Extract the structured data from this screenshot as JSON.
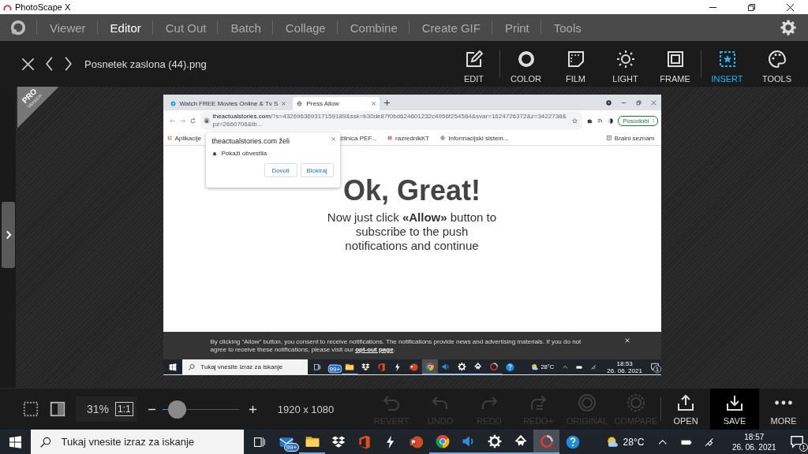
{
  "window": {
    "title": "PhotoScape X"
  },
  "menu": [
    {
      "label": "Viewer",
      "selected": false
    },
    {
      "label": "Editor",
      "selected": true
    },
    {
      "label": "Cut Out",
      "selected": false
    },
    {
      "label": "Batch",
      "selected": false
    },
    {
      "label": "Collage",
      "selected": false
    },
    {
      "label": "Combine",
      "selected": false
    },
    {
      "label": "Create GIF",
      "selected": false
    },
    {
      "label": "Print",
      "selected": false
    },
    {
      "label": "Tools",
      "selected": false
    }
  ],
  "file_name": "Posnetek zaslona (44).png",
  "tool_groups": [
    [
      {
        "kind": "edit",
        "label": "EDIT",
        "selected": false
      }
    ],
    [
      {
        "kind": "color",
        "label": "COLOR",
        "selected": false
      },
      {
        "kind": "film",
        "label": "FILM",
        "selected": false
      },
      {
        "kind": "light",
        "label": "LIGHT",
        "selected": false
      },
      {
        "kind": "frame",
        "label": "FRAME",
        "selected": false
      }
    ],
    [
      {
        "kind": "insert",
        "label": "INSERT",
        "selected": true
      },
      {
        "kind": "palette",
        "label": "TOOLS",
        "selected": false
      }
    ]
  ],
  "pro_ribbon": {
    "title": "PRO",
    "subtitle": "Version"
  },
  "screenshot": {
    "tabs": [
      {
        "kind": "video",
        "title": "Watch FREE Movies Online & Tv S",
        "selected": false
      },
      {
        "kind": "globe",
        "title": "Press Allow",
        "selected": true
      }
    ],
    "url_host": "theactualstories.com",
    "url_rest": "/?s=432696369317159189&ssk=b30de87f0bd624601232c4956f254584&svar=1624726372&z=3422738&pz=2660706&tb...",
    "update_button": "Posodobi",
    "bookmarks": [
      {
        "kind": "apps",
        "label": "Aplikacije"
      },
      {
        "kind": "none",
        "label": "čilnica PEF..."
      },
      {
        "kind": "flag",
        "label": "razrednikKT"
      },
      {
        "kind": "globe",
        "label": "Informacijski sistem..."
      }
    ],
    "reading_list": "Bralni seznam",
    "popup": {
      "title": "theactualstories.com želi",
      "permission": "Pokaži obvestila",
      "buttons": [
        "Dovoli",
        "Blokiraj"
      ]
    },
    "heading": "Ok, Great!",
    "message": "Now just click **«Allow»** button to subscribe to the push notifications and continue",
    "notice": {
      "text": "By clicking \"Allow\" button, you consent to receive notifications. The notifications provide news and advertising materials. If you do not agree to receive these notifications, please visit our",
      "link": "opt-out page",
      "end": "."
    },
    "taskbar": {
      "search_placeholder": "Tukaj vnesite izraz za iskanje",
      "apps": [
        {
          "kind": "mail",
          "badge": "99+",
          "running": false,
          "selected": false
        },
        {
          "kind": "folder",
          "running": true,
          "selected": false
        },
        {
          "kind": "dropbox",
          "running": false,
          "selected": false
        },
        {
          "kind": "office",
          "running": false,
          "selected": false
        },
        {
          "kind": "bolt",
          "running": false,
          "selected": false
        },
        {
          "kind": "powerpoint",
          "running": false,
          "selected": false
        },
        {
          "kind": "chrome",
          "running": true,
          "selected": true
        },
        {
          "kind": "speaker",
          "running": true,
          "selected": false
        },
        {
          "kind": "gear",
          "running": true,
          "selected": false
        },
        {
          "kind": "ink",
          "running": true,
          "selected": false
        },
        {
          "kind": "ring",
          "running": true,
          "selected": false
        },
        {
          "kind": "help",
          "running": false,
          "selected": false
        }
      ],
      "temperature": "28°C",
      "time": "18:53",
      "date": "26. 06. 2021",
      "notifications": "1"
    }
  },
  "bottom_bar": {
    "zoom": "31%",
    "actual_size": "1:1",
    "zoom_slider": {
      "level": 0.19
    },
    "dimensions": "1920 x 1080",
    "actions": [
      {
        "kind": "revert",
        "label": "REVERT",
        "disabled": true,
        "selected": false
      },
      {
        "kind": "undo",
        "label": "UNDO",
        "disabled": true,
        "selected": false
      },
      {
        "kind": "redo",
        "label": "REDO",
        "disabled": true,
        "selected": false
      },
      {
        "kind": "redo-plus",
        "label": "REDO+",
        "disabled": true,
        "selected": false
      },
      {
        "kind": "original",
        "label": "ORIGINAL",
        "disabled": true,
        "selected": false
      },
      {
        "kind": "compare",
        "label": "COMPARE",
        "disabled": true,
        "selected": false
      },
      {
        "kind": "open",
        "label": "OPEN",
        "disabled": false,
        "selected": false
      },
      {
        "kind": "save",
        "label": "SAVE",
        "disabled": false,
        "selected": true
      },
      {
        "kind": "more",
        "label": "MORE",
        "disabled": false,
        "selected": false
      }
    ]
  },
  "taskbar": {
    "search_placeholder": "Tukaj vnesite izraz za iskanje",
    "apps": [
      {
        "kind": "mail",
        "badge": "99+",
        "running": false,
        "selected": false
      },
      {
        "kind": "folder",
        "running": true,
        "selected": false
      },
      {
        "kind": "dropbox",
        "running": false,
        "selected": false
      },
      {
        "kind": "office",
        "running": false,
        "selected": false
      },
      {
        "kind": "bolt",
        "running": false,
        "selected": false
      },
      {
        "kind": "powerpoint",
        "running": false,
        "selected": false
      },
      {
        "kind": "chrome",
        "running": true,
        "selected": false
      },
      {
        "kind": "speaker",
        "running": true,
        "selected": false
      },
      {
        "kind": "gear",
        "running": true,
        "selected": false
      },
      {
        "kind": "ink",
        "running": true,
        "selected": false
      },
      {
        "kind": "ring",
        "running": true,
        "selected": true
      },
      {
        "kind": "help",
        "running": false,
        "selected": false
      }
    ],
    "temperature": "28°C",
    "time": "18:57",
    "date": "26. 06. 2021",
    "notifications": "1"
  }
}
